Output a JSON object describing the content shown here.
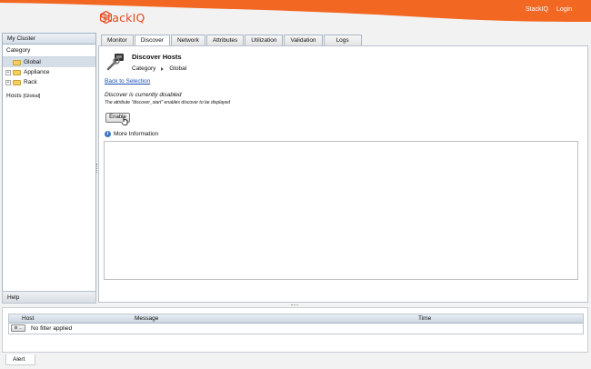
{
  "brand": {
    "name": "StackIQ",
    "accent": "#f26722"
  },
  "header": {
    "links": [
      "StackIQ",
      "Login"
    ]
  },
  "left_panel": {
    "title": "My Cluster",
    "category_label": "Category",
    "tree": [
      {
        "label": "Global",
        "selected": true,
        "expandable": false
      },
      {
        "label": "Appliance",
        "selected": false,
        "expandable": true
      },
      {
        "label": "Rack",
        "selected": false,
        "expandable": true
      }
    ],
    "hosts_label": "Hosts",
    "hosts_value": "[Global]",
    "help_label": "Help"
  },
  "tabs": [
    "Monitor",
    "Discover",
    "Network",
    "Attributes",
    "Utilization",
    "Validation",
    "Logs"
  ],
  "active_tab": "Discover",
  "main": {
    "title": "Discover Hosts",
    "breadcrumb": [
      "Category",
      "Global"
    ],
    "back_link": "Back to Selection",
    "status": "Discover is currently disabled",
    "note": "The attribute \"discover_start\" enables discover to be displayed",
    "enable_label": "Enable",
    "more_info_label": "More Information"
  },
  "bottom": {
    "columns": [
      "Host",
      "Message",
      "Time"
    ],
    "empty_message": "No filter applied",
    "filter_button_label": "⚙ ...",
    "tab_label": "Alert"
  }
}
